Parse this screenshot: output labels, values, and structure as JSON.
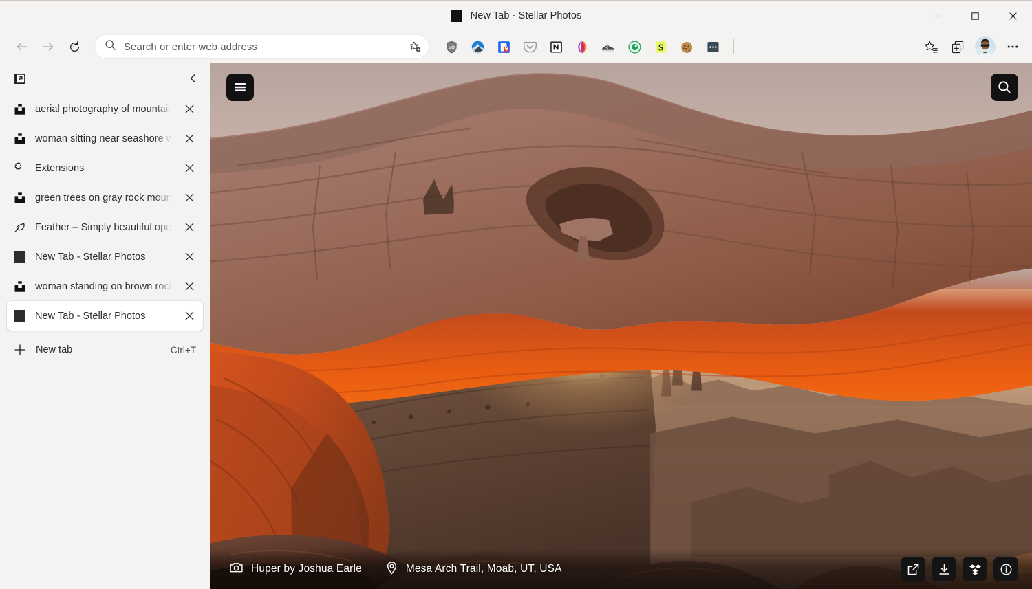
{
  "window": {
    "title": "New Tab - Stellar Photos",
    "favicon": "black-square-favicon",
    "controls": {
      "minimize": "Minimize",
      "maximize": "Maximize",
      "close": "Close"
    }
  },
  "toolbar": {
    "back_label": "Back",
    "forward_label": "Forward",
    "refresh_label": "Refresh",
    "address": {
      "placeholder": "Search or enter web address",
      "value": "",
      "search_icon": "search-icon",
      "favorite_icon": "add-favorite-star-icon"
    },
    "extensions": [
      {
        "name": "ublock-origin",
        "label": "uBlock Origin"
      },
      {
        "name": "blue-wave",
        "label": "Wave"
      },
      {
        "name": "door-lock",
        "label": "Door"
      },
      {
        "name": "pocket",
        "label": "Pocket"
      },
      {
        "name": "notion",
        "label": "Notion"
      },
      {
        "name": "colorful-swirl",
        "label": "Swirl"
      },
      {
        "name": "sneaker",
        "label": "Sneaker"
      },
      {
        "name": "green-circle",
        "label": "Green Circle"
      },
      {
        "name": "letter-s",
        "label": "S"
      },
      {
        "name": "cookie",
        "label": "Cookie"
      },
      {
        "name": "dots-box",
        "label": "More Extensions"
      }
    ],
    "favorites_label": "Favorites",
    "collections_label": "Collections",
    "profile_label": "Profile",
    "settings_label": "Settings and more"
  },
  "sidebar": {
    "header_icon": "vertical-tabs-icon",
    "collapse_label": "Collapse tab list",
    "tabs": [
      {
        "icon": "unsplash-icon",
        "label": "aerial photography of mountains",
        "active": false
      },
      {
        "icon": "unsplash-icon",
        "label": "woman sitting near seashore whi",
        "active": false
      },
      {
        "icon": "extensions-icon",
        "label": "Extensions",
        "active": false
      },
      {
        "icon": "unsplash-icon",
        "label": "green trees on gray rock mounta",
        "active": false
      },
      {
        "icon": "feather-icon",
        "label": "Feather – Simply beautiful open s",
        "active": false
      },
      {
        "icon": "black-square",
        "label": "New Tab - Stellar Photos",
        "active": false
      },
      {
        "icon": "unsplash-icon",
        "label": "woman standing on brown rock t",
        "active": false
      },
      {
        "icon": "black-square",
        "label": "New Tab - Stellar Photos",
        "active": true
      }
    ],
    "new_tab": {
      "label": "New tab",
      "shortcut": "Ctrl+T",
      "icon": "plus-icon"
    }
  },
  "page": {
    "menu_button": "hamburger-menu-icon",
    "search_button": "search-icon",
    "credit": {
      "icon": "camera-icon",
      "text": "Huper by Joshua Earle"
    },
    "location": {
      "icon": "location-pin-icon",
      "text": "Mesa Arch Trail, Moab, UT, USA"
    },
    "actions": [
      {
        "name": "open-external-icon",
        "label": "Open photo"
      },
      {
        "name": "download-icon",
        "label": "Download"
      },
      {
        "name": "dropbox-icon",
        "label": "Save to Dropbox"
      },
      {
        "name": "info-icon",
        "label": "Photo info"
      }
    ]
  },
  "colors": {
    "chrome_bg": "#f4f3f2",
    "active_tab_bg": "#ffffff",
    "text": "#2e2e2e",
    "button_dark": "#121212"
  }
}
